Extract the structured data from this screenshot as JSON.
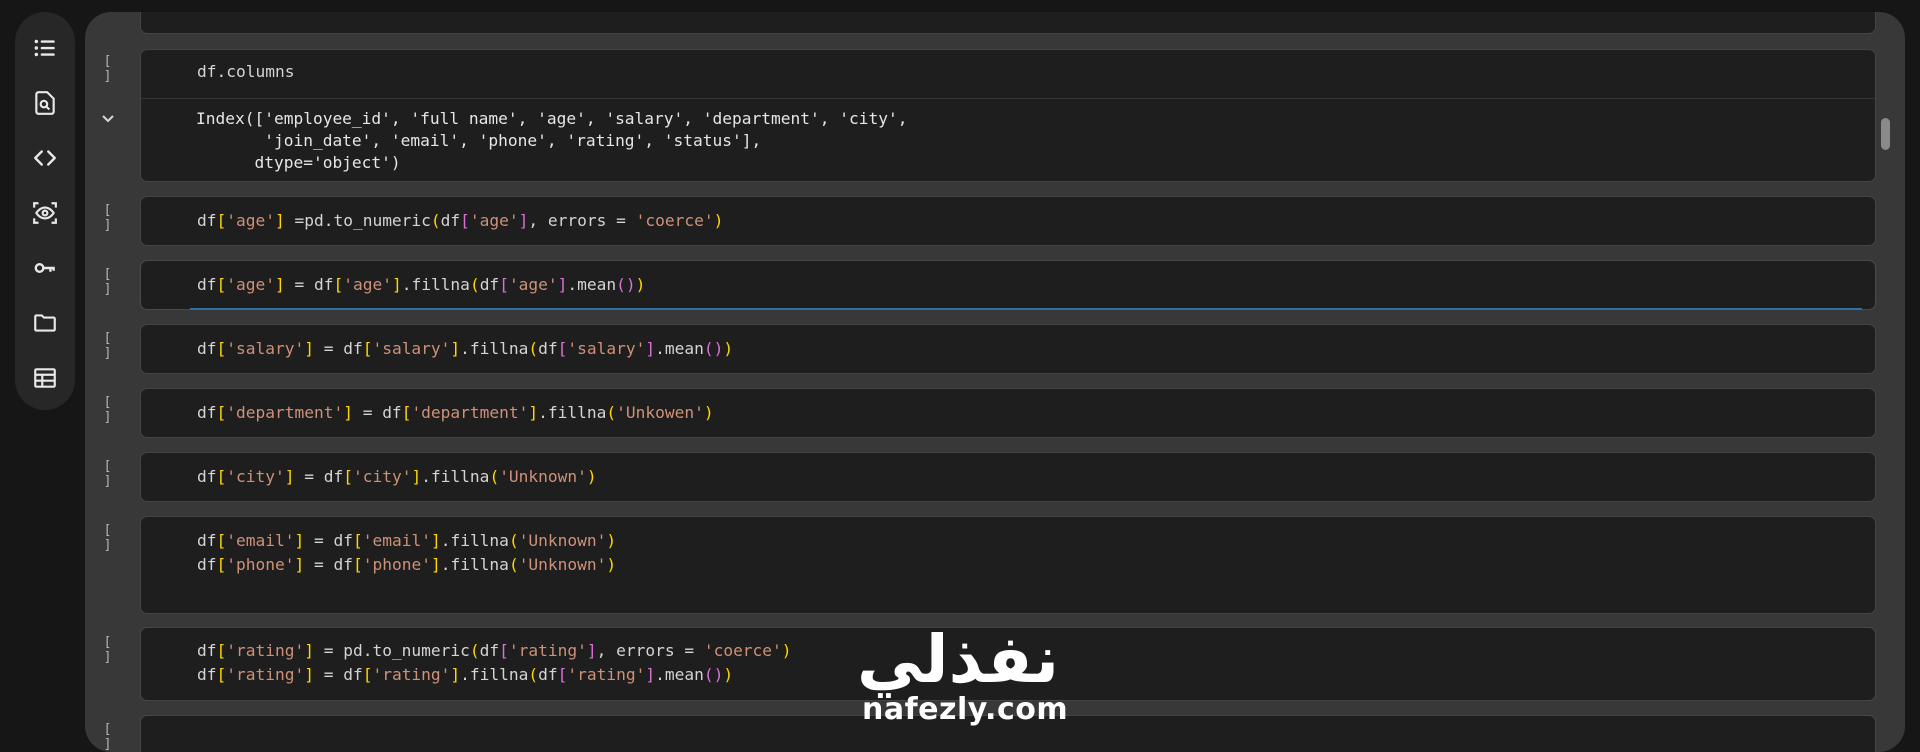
{
  "sidebar": {
    "items": [
      {
        "icon": "table-of-contents-icon"
      },
      {
        "icon": "find-replace-icon"
      },
      {
        "icon": "code-snippets-icon"
      },
      {
        "icon": "variables-inspector-icon"
      },
      {
        "icon": "secrets-key-icon"
      },
      {
        "icon": "files-folder-icon"
      },
      {
        "icon": "data-table-icon"
      }
    ]
  },
  "cells": [
    {
      "exec": "[ ]",
      "code": "df.columns",
      "output": "Index(['employee_id', 'full name', 'age', 'salary', 'department', 'city',\n       'join_date', 'email', 'phone', 'rating', 'status'],\n      dtype='object')"
    },
    {
      "exec": "[ ]",
      "code": "df['age'] =pd.to_numeric(df['age'], errors = 'coerce')"
    },
    {
      "exec": "[ ]",
      "code": "df['age'] = df['age'].fillna(df['age'].mean())"
    },
    {
      "exec": "[ ]",
      "code": "df['salary'] = df['salary'].fillna(df['salary'].mean())"
    },
    {
      "exec": "[ ]",
      "code": "df['department'] = df['department'].fillna('Unkowen')"
    },
    {
      "exec": "[ ]",
      "code": "df['city'] = df['city'].fillna('Unknown')"
    },
    {
      "exec": "[ ]",
      "code": "df['email'] = df['email'].fillna('Unknown')\ndf['phone'] = df['phone'].fillna('Unknown')"
    },
    {
      "exec": "[ ]",
      "code": "df['rating'] = pd.to_numeric(df['rating'], errors = 'coerce')\ndf['rating'] = df['rating'].fillna(df['rating'].mean())"
    },
    {
      "exec": "[ ]",
      "code": ""
    }
  ],
  "watermark": {
    "arabic": "نفذلي",
    "domain": "nafezly.com"
  },
  "colors": {
    "string": "#ce9178",
    "bracket_level1": "#ffd700",
    "bracket_level2": "#da70d6",
    "bracket_level3": "#179fff",
    "editor_focus": "#2f6ea8"
  }
}
